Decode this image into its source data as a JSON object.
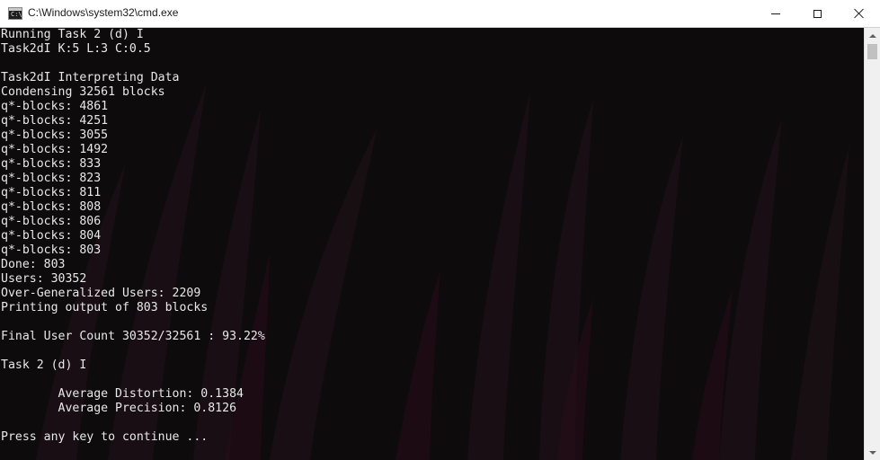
{
  "window": {
    "title": "C:\\Windows\\system32\\cmd.exe",
    "icon": "cmd-icon",
    "buttons": {
      "minimize": "minimize-icon",
      "maximize": "maximize-icon",
      "close": "close-icon"
    }
  },
  "colors": {
    "titlebar_bg": "#ffffff",
    "console_bg": "#0c0c0c",
    "console_text": "#e8e8e8",
    "scrollbar_bg": "#f0f0f0",
    "scroll_thumb": "#c1c1c1",
    "background_art_accent": "#3a1020"
  },
  "console": {
    "lines": [
      "Running Task 2 (d) I",
      "Task2dI K:5 L:3 C:0.5",
      "",
      "Task2dI Interpreting Data",
      "Condensing 32561 blocks",
      "q*-blocks: 4861",
      "q*-blocks: 4251",
      "q*-blocks: 3055",
      "q*-blocks: 1492",
      "q*-blocks: 833",
      "q*-blocks: 823",
      "q*-blocks: 811",
      "q*-blocks: 808",
      "q*-blocks: 806",
      "q*-blocks: 804",
      "q*-blocks: 803",
      "Done: 803",
      "Users: 30352",
      "Over-Generalized Users: 2209",
      "Printing output of 803 blocks",
      "",
      "Final User Count 30352/32561 : 93.22%",
      "",
      "Task 2 (d) I",
      "",
      "        Average Distortion: 0.1384",
      "        Average Precision: 0.8126",
      "",
      "Press any key to continue ..."
    ]
  }
}
